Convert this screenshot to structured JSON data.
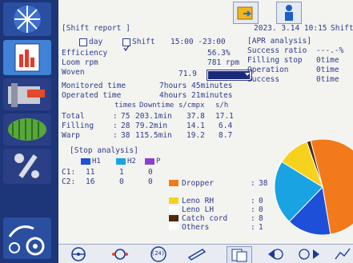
{
  "header": {
    "title": "[Shift report ]",
    "datetime": "2023. 3.14 10:15",
    "shift_label": "Shift"
  },
  "filters": {
    "day_label": "day",
    "shift_label": "Shift",
    "shift_range": "15:00 -23:00",
    "shift_checked": true
  },
  "stats": [
    {
      "label": "Efficiency",
      "value": "56.3%"
    },
    {
      "label": "Loom rpm",
      "value": "781 rpm"
    },
    {
      "label": "Woven",
      "value": "71.9"
    },
    {
      "label": "Monitored time",
      "value": "7hours 45minutes"
    },
    {
      "label": "Operated time",
      "value": "4hours 21minutes"
    }
  ],
  "woven_unit_select": {
    "value": ""
  },
  "apr": {
    "title": "[APR analysis]",
    "rows": [
      {
        "label": "Success ratio",
        "value": "---.-%"
      },
      {
        "label": "Filling stop",
        "value": "0time"
      },
      {
        "label": "Operation",
        "value": "0time"
      },
      {
        "label": "Success",
        "value": "0time"
      }
    ]
  },
  "stop_table": {
    "headers": [
      "times",
      "Downtime",
      "s/cmpx",
      "s/h"
    ],
    "rows": [
      {
        "label": "Total",
        "times": "75",
        "downtime": "203.1min",
        "scmpx": "37.8",
        "sh": "17.1"
      },
      {
        "label": "Filling",
        "times": "28",
        "downtime": "79.2min",
        "scmpx": "14.1",
        "sh": "6.4"
      },
      {
        "label": "Warp",
        "times": "38",
        "downtime": "115.5min",
        "scmpx": "19.2",
        "sh": "8.7"
      }
    ]
  },
  "stop_analysis": {
    "title": "[Stop analysis]",
    "legend": [
      {
        "label": "H1",
        "color": "#1e4fd8"
      },
      {
        "label": "H2",
        "color": "#19a3e3"
      },
      {
        "label": "P",
        "color": "#8a3fd0"
      }
    ],
    "rows": [
      {
        "label": "C1:",
        "values": [
          "11",
          "1",
          "0"
        ]
      },
      {
        "label": "C2:",
        "values": [
          "16",
          "0",
          "0"
        ]
      }
    ],
    "causes": [
      {
        "label": "Dropper",
        "count": "38",
        "color": "#f27a1a"
      },
      {
        "label": "Leno RH",
        "count": "0",
        "color": "#f6d21e"
      },
      {
        "label": "Leno LH",
        "count": "0",
        "color": "#ffffff"
      },
      {
        "label": "Catch cord",
        "count": "8",
        "color": "#4a2a10"
      },
      {
        "label": "Others",
        "count": "1",
        "color": "#ffffff"
      }
    ]
  },
  "pie": {
    "slices": [
      {
        "label": "Dropper",
        "value": 38,
        "color": "#f27a1a"
      },
      {
        "label": "H1",
        "value": 11,
        "color": "#1e4fd8"
      },
      {
        "label": "H2",
        "value": 16,
        "color": "#19a3e3"
      },
      {
        "label": "Catch cord",
        "value": 8,
        "color": "#f6d21e"
      },
      {
        "label": "Others",
        "value": 1,
        "color": "#4a2a10"
      }
    ]
  },
  "bottom_bar": {
    "page_label": "(24)"
  }
}
